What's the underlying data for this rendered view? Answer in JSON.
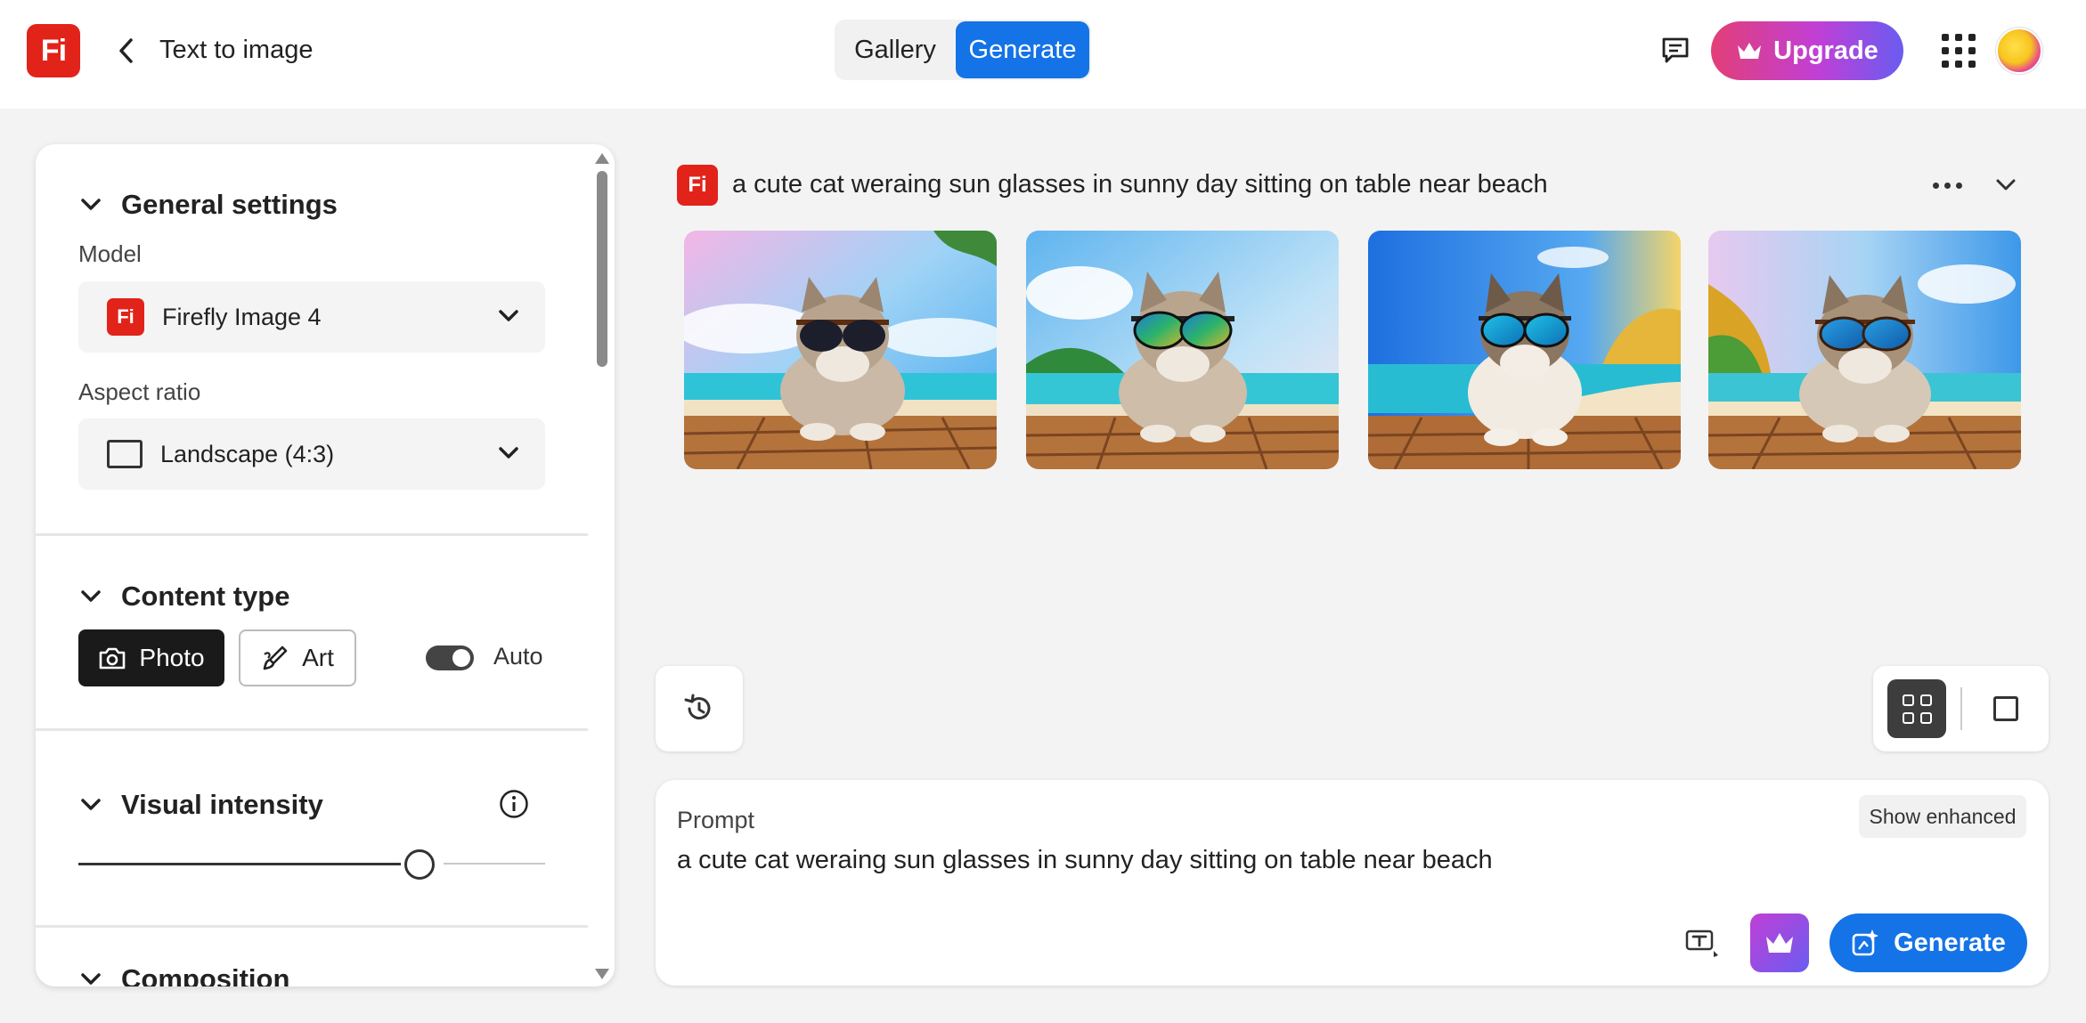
{
  "app": {
    "logo_text": "Fi",
    "page_title": "Text to image"
  },
  "header": {
    "tabs": [
      {
        "label": "Gallery",
        "active": false
      },
      {
        "label": "Generate",
        "active": true
      }
    ],
    "upgrade_label": "Upgrade",
    "icons": [
      "chevron-left-icon",
      "feedback-icon",
      "crown-icon",
      "apps-grid-icon",
      "avatar"
    ]
  },
  "panel": {
    "general": {
      "header": "General settings",
      "model_label": "Model",
      "model_value": "Firefly Image 4",
      "model_icon_text": "Fi",
      "aspect_label": "Aspect ratio",
      "aspect_value": "Landscape (4:3)"
    },
    "content_type": {
      "header": "Content type",
      "photo_label": "Photo",
      "art_label": "Art",
      "auto_label": "Auto",
      "auto_on": true,
      "selected": "Photo"
    },
    "visual_intensity": {
      "header": "Visual intensity",
      "value_fraction": 0.73
    },
    "composition": {
      "header": "Composition"
    }
  },
  "results": {
    "logo_text": "Fi",
    "prompt": "a cute cat weraing sun glasses in sunny day sitting on table near beach",
    "images": [
      {
        "name": "generated-image-1",
        "lens": "dark"
      },
      {
        "name": "generated-image-2",
        "lens": "rainbow"
      },
      {
        "name": "generated-image-3",
        "lens": "blue"
      },
      {
        "name": "generated-image-4",
        "lens": "blue"
      }
    ]
  },
  "prompt_box": {
    "label": "Prompt",
    "show_enhanced": "Show enhanced",
    "value": "a cute cat weraing sun glasses in sunny day sitting on table near beach",
    "generate_label": "Generate"
  },
  "colors": {
    "brand_red": "#e2231a",
    "accent_blue": "#1473e6",
    "upgrade_gradient": [
      "#e23f77",
      "#c13fd6",
      "#6a5cf0"
    ]
  }
}
